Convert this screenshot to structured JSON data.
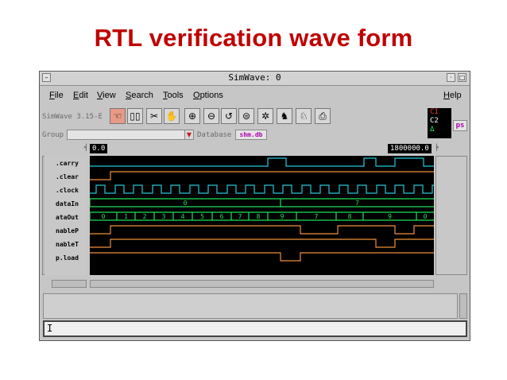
{
  "slide": {
    "title": "RTL verification  wave form"
  },
  "window": {
    "title": "SimWave: 0",
    "menu_btn_icon": "window-menu-icon",
    "minimize_icon": "minimize-icon",
    "maximize_icon": "maximize-icon"
  },
  "menubar": {
    "left": [
      "File",
      "Edit",
      "View",
      "Search",
      "Tools",
      "Options"
    ],
    "help": "Help"
  },
  "toolbar": {
    "version": "SimWave 3.15-E",
    "tools": [
      "pointer-icon",
      "zoom-fit-icon",
      "cut-icon",
      "hand-icon",
      "zoom-in-icon",
      "zoom-out-icon",
      "zoom-undo-icon",
      "zoom-full-icon",
      "refresh-icon",
      "run-left-icon",
      "run-right-icon",
      "print-icon"
    ],
    "markers": [
      "C1",
      "C2",
      "Δ"
    ],
    "ps_label": "ps"
  },
  "group_bar": {
    "group_label": "Group",
    "database_label": "Database",
    "database_value": "shm.db"
  },
  "cursors": {
    "left": "0.0",
    "right": "1800000.0"
  },
  "signals": [
    ".carry",
    ".clear",
    ".clock",
    "dataIn",
    "ataOut",
    "nableP",
    "nableT",
    "p.load"
  ],
  "colors": {
    "wave_green": "#22e05a",
    "wave_orange": "#f0903a",
    "wave_cyan": "#25c8d8",
    "bg_black": "#000000"
  },
  "chart_data": {
    "type": "digital-waveform",
    "x_range": [
      0,
      1800000
    ],
    "dataIn_values": [
      "0",
      "7"
    ],
    "dataOut_values": [
      "0",
      "1",
      "2",
      "3",
      "4",
      "5",
      "6",
      "7",
      "8",
      "9",
      "7",
      "8",
      "9",
      "0"
    ]
  },
  "cmdline": {
    "text": "I"
  }
}
